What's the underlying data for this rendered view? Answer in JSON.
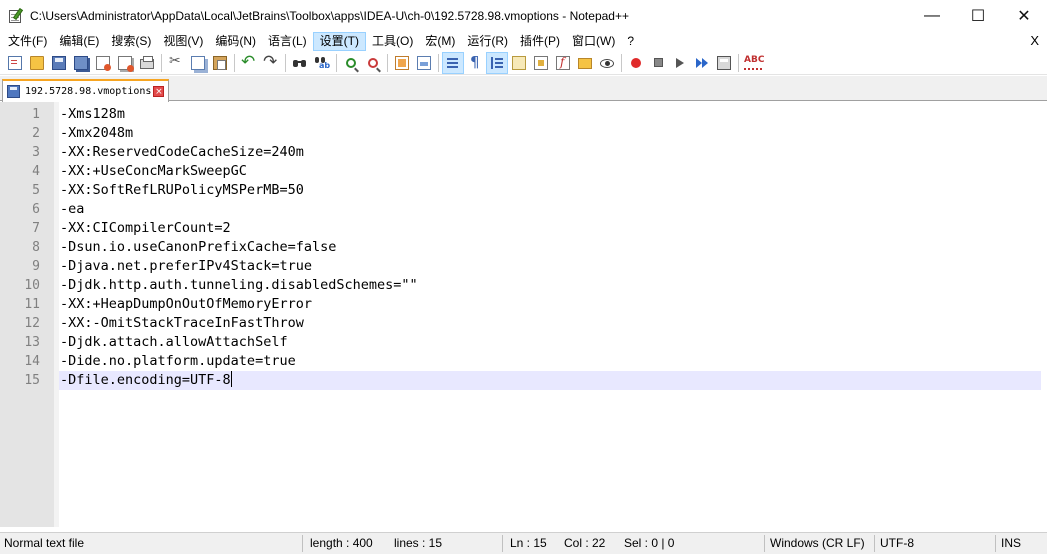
{
  "window": {
    "title": "C:\\Users\\Administrator\\AppData\\Local\\JetBrains\\Toolbox\\apps\\IDEA-U\\ch-0\\192.5728.98.vmoptions - Notepad++",
    "minimize": "—",
    "maximize": "☐",
    "close": "✕"
  },
  "menu": {
    "items": [
      "文件(F)",
      "编辑(E)",
      "搜索(S)",
      "视图(V)",
      "编码(N)",
      "语言(L)",
      "设置(T)",
      "工具(O)",
      "宏(M)",
      "运行(R)",
      "插件(P)",
      "窗口(W)",
      "?"
    ],
    "active_index": 6,
    "close_doc": "X"
  },
  "toolbar": {
    "icons": [
      "new-file-icon",
      "open-file-icon",
      "save-icon",
      "save-all-icon",
      "close-icon",
      "close-all-icon",
      "print-icon",
      "cut-icon",
      "copy-icon",
      "paste-icon",
      "undo-icon",
      "redo-icon",
      "find-icon",
      "replace-icon",
      "zoom-in-icon",
      "zoom-out-icon",
      "sync-vertical-icon",
      "sync-horizontal-icon",
      "word-wrap-icon",
      "show-all-chars-icon",
      "indent-guide-icon",
      "user-language-icon",
      "document-map-icon",
      "function-list-icon",
      "folder-workspace-icon",
      "monitoring-icon",
      "macro-record-icon",
      "macro-stop-icon",
      "macro-play-icon",
      "macro-play-multiple-icon",
      "macro-save-icon",
      "spell-check-icon"
    ]
  },
  "tab": {
    "label": "192.5728.98.vmoptions",
    "close": "×"
  },
  "editor": {
    "current_line": 15,
    "lines": [
      {
        "num": "1",
        "text": "-Xms128m"
      },
      {
        "num": "2",
        "text": "-Xmx2048m"
      },
      {
        "num": "3",
        "text": "-XX:ReservedCodeCacheSize=240m"
      },
      {
        "num": "4",
        "text": "-XX:+UseConcMarkSweepGC"
      },
      {
        "num": "5",
        "text": "-XX:SoftRefLRUPolicyMSPerMB=50"
      },
      {
        "num": "6",
        "text": "-ea"
      },
      {
        "num": "7",
        "text": "-XX:CICompilerCount=2"
      },
      {
        "num": "8",
        "text": "-Dsun.io.useCanonPrefixCache=false"
      },
      {
        "num": "9",
        "text": "-Djava.net.preferIPv4Stack=true"
      },
      {
        "num": "10",
        "text": "-Djdk.http.auth.tunneling.disabledSchemes=\"\""
      },
      {
        "num": "11",
        "text": "-XX:+HeapDumpOnOutOfMemoryError"
      },
      {
        "num": "12",
        "text": "-XX:-OmitStackTraceInFastThrow"
      },
      {
        "num": "13",
        "text": "-Djdk.attach.allowAttachSelf"
      },
      {
        "num": "14",
        "text": "-Dide.no.platform.update=true"
      },
      {
        "num": "15",
        "text": "-Dfile.encoding=UTF-8"
      }
    ]
  },
  "status": {
    "file_type": "Normal text file",
    "length": "length : 400",
    "lines": "lines : 15",
    "ln": "Ln : 15",
    "col": "Col : 22",
    "sel": "Sel : 0 | 0",
    "eol": "Windows (CR LF)",
    "encoding": "UTF-8",
    "mode": "INS"
  }
}
